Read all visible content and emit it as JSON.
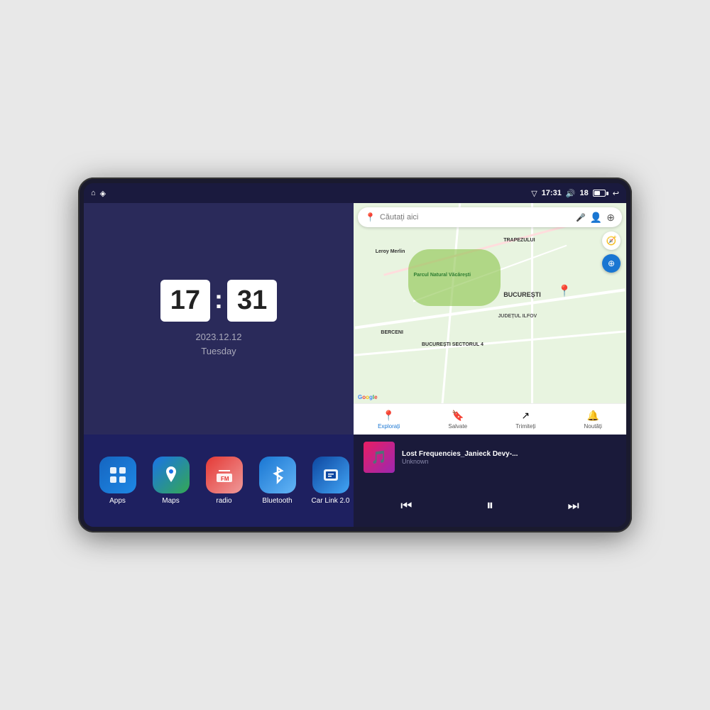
{
  "device": {
    "status_bar": {
      "nav_icon": "▽",
      "location_icon": "◈",
      "time": "17:31",
      "volume_icon": "🔊",
      "battery_level": "18",
      "battery_icon": "🔋",
      "back_icon": "↩"
    },
    "clock": {
      "hour": "17",
      "minute": "31",
      "date": "2023.12.12",
      "day": "Tuesday"
    },
    "map": {
      "search_placeholder": "Căutați aici",
      "park_label": "Parcul Natural Văcărești",
      "store_label": "Leroy Merlin",
      "district_label": "BUCUREȘTI SECTORUL 4",
      "city_label": "BUCUREȘTI",
      "county_label": "JUDEȚUL ILFOV",
      "area_label1": "BERCENI",
      "area_label2": "TRAPEZULUI",
      "nav_items": [
        {
          "icon": "📍",
          "label": "Explorați",
          "active": true
        },
        {
          "icon": "🔖",
          "label": "Salvate",
          "active": false
        },
        {
          "icon": "↗",
          "label": "Trimiteți",
          "active": false
        },
        {
          "icon": "🔔",
          "label": "Noutăți",
          "active": false
        }
      ]
    },
    "apps": [
      {
        "id": "apps",
        "label": "Apps",
        "icon": "⊞",
        "class": "app-apps"
      },
      {
        "id": "maps",
        "label": "Maps",
        "icon": "📍",
        "class": "app-maps"
      },
      {
        "id": "radio",
        "label": "radio",
        "icon": "📻",
        "class": "app-radio"
      },
      {
        "id": "bluetooth",
        "label": "Bluetooth",
        "icon": "᪂",
        "class": "app-bluetooth"
      },
      {
        "id": "carlink",
        "label": "Car Link 2.0",
        "icon": "📱",
        "class": "app-carlink"
      }
    ],
    "music": {
      "title": "Lost Frequencies_Janieck Devy-...",
      "artist": "Unknown",
      "controls": {
        "prev": "⏮",
        "play_pause": "⏸",
        "next": "⏭"
      }
    }
  }
}
